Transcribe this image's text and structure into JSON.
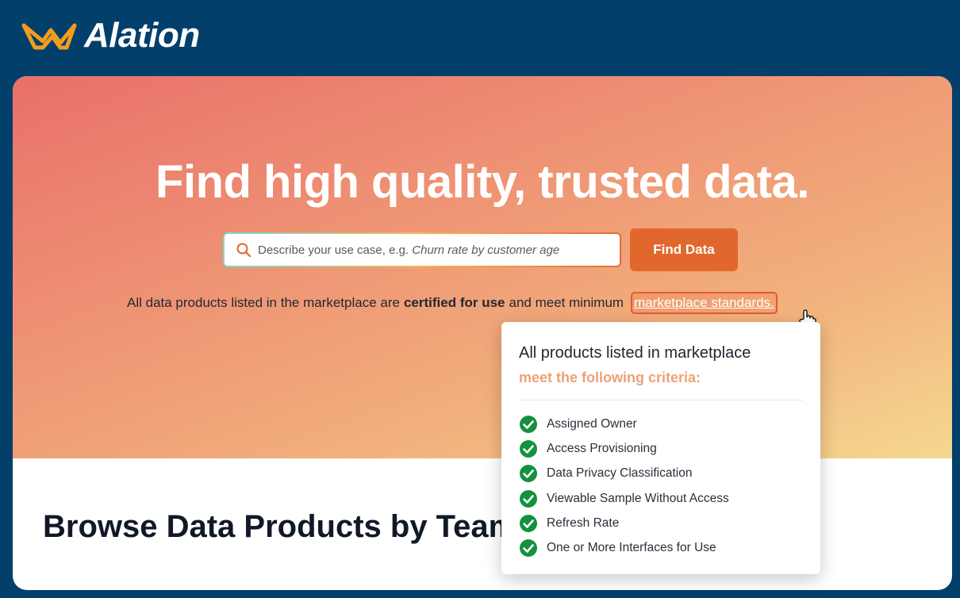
{
  "brand": {
    "name": "Alation",
    "mark_color": "#f39c1d",
    "icon": "alation-logo-icon"
  },
  "colors": {
    "page_bg": "#033f6b",
    "accent": "#e2672c",
    "check_green": "#13913f",
    "criteria_heading": "#eea277"
  },
  "hero": {
    "title": "Find high quality, trusted data.",
    "search": {
      "placeholder_prefix": "Describe your use case, e.g. ",
      "placeholder_example": "Churn rate by customer age",
      "icon": "search-icon"
    },
    "find_button_label": "Find Data",
    "notice": {
      "prefix": "All data products listed in the marketplace are",
      "bold": "certified for use",
      "suffix": "and meet minimum",
      "link": "marketplace standards."
    }
  },
  "browse": {
    "title": "Browse Data Products by Team"
  },
  "popover": {
    "line1": "All products listed in marketplace",
    "line2": "meet the following criteria:",
    "criteria": [
      "Assigned Owner",
      "Access Provisioning",
      "Data Privacy Classification",
      "Viewable Sample Without Access",
      "Refresh Rate",
      "One or More Interfaces for Use"
    ]
  }
}
